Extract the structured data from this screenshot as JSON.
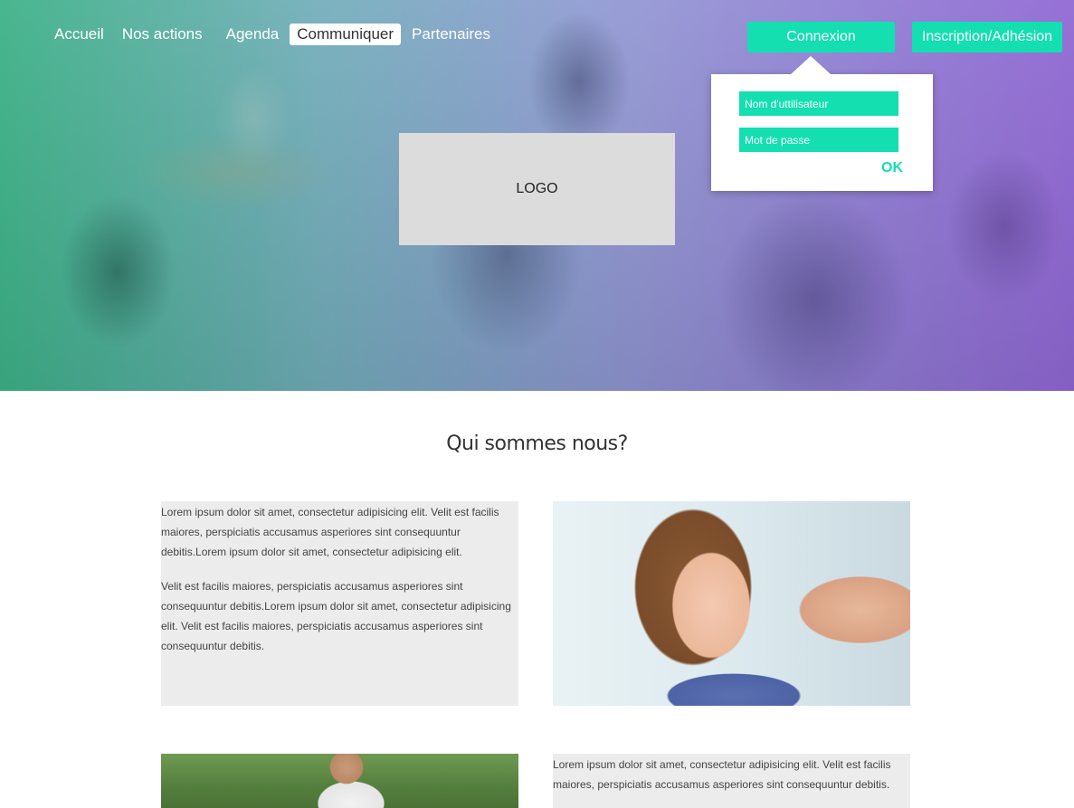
{
  "nav": {
    "items": [
      {
        "label": "Accueil",
        "active": false
      },
      {
        "label": "Nos actions",
        "active": false
      },
      {
        "label": "Agenda",
        "active": false
      },
      {
        "label": "Communiquer",
        "active": true
      },
      {
        "label": "Partenaires",
        "active": false
      }
    ]
  },
  "header": {
    "connexion_label": "Connexion",
    "inscription_label": "Inscription/Adhésion"
  },
  "login": {
    "username_placeholder": "Nom d'uttilisateur",
    "password_placeholder": "Mot de passe",
    "ok_label": "OK"
  },
  "hero": {
    "logo_text": "LOGO"
  },
  "about": {
    "title": "Qui sommes nous?",
    "block1": {
      "p1": "Lorem ipsum dolor sit amet, consectetur adipisicing elit. Velit est facilis maiores, perspiciatis accusamus asperiores sint consequuntur debitis.Lorem ipsum dolor sit amet, consectetur adipisicing elit.",
      "p2": "Velit est facilis maiores, perspiciatis accusamus asperiores sint consequuntur debitis.Lorem ipsum dolor sit amet, consectetur adipisicing elit. Velit est facilis maiores, perspiciatis accusamus asperiores sint consequuntur debitis."
    },
    "block2": {
      "p1": "Lorem ipsum dolor sit amet, consectetur adipisicing elit. Velit est facilis maiores, perspiciatis accusamus asperiores sint consequuntur debitis."
    }
  },
  "colors": {
    "accent": "#13dfb1",
    "text_block_bg": "#ececec",
    "logo_bg": "#dcdcdc"
  }
}
